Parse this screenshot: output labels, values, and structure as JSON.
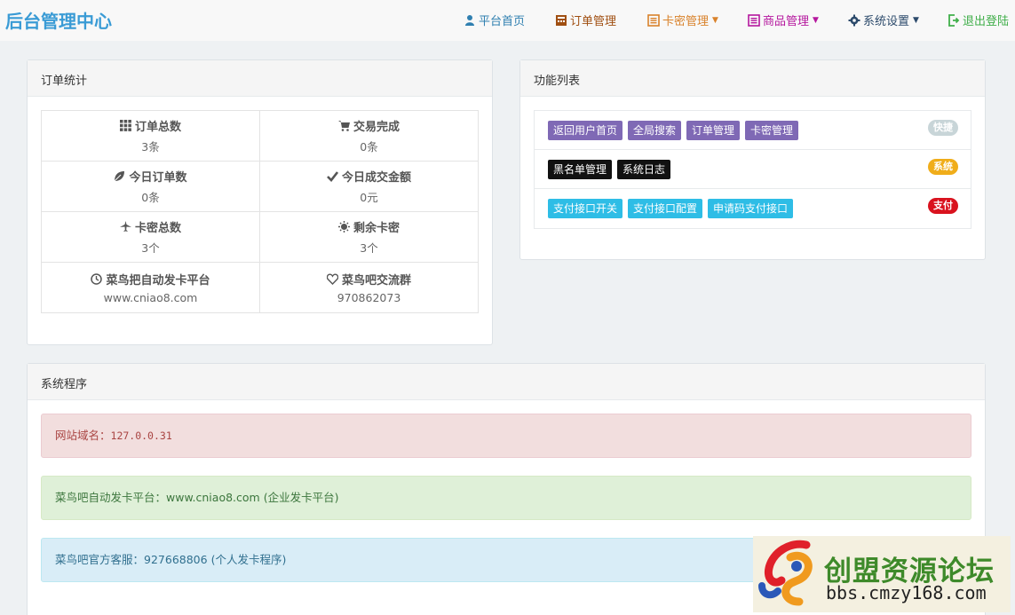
{
  "brand": "后台管理中心",
  "nav": [
    {
      "label": "平台首页",
      "color": "#2f7fb0",
      "icon": "user-icon",
      "dropdown": false
    },
    {
      "label": "订单管理",
      "color": "#a04f12",
      "icon": "calculator-icon",
      "dropdown": false
    },
    {
      "label": "卡密管理",
      "color": "#d9822b",
      "icon": "list-icon",
      "dropdown": true
    },
    {
      "label": "商品管理",
      "color": "#b5179e",
      "icon": "book-icon",
      "dropdown": true
    },
    {
      "label": "系统设置",
      "color": "#2c4a6b",
      "icon": "gear-icon",
      "dropdown": true
    },
    {
      "label": "退出登陆",
      "color": "#3fae49",
      "icon": "logout-icon",
      "dropdown": false
    }
  ],
  "order_stats": {
    "title": "订单统计",
    "cells": [
      {
        "label": "订单总数",
        "value": "3条",
        "icon": "grid-icon"
      },
      {
        "label": "交易完成",
        "value": "0条",
        "icon": "cart-icon"
      },
      {
        "label": "今日订单数",
        "value": "0条",
        "icon": "leaf-icon"
      },
      {
        "label": "今日成交金额",
        "value": "0元",
        "icon": "check-icon"
      },
      {
        "label": "卡密总数",
        "value": "3个",
        "icon": "plane-icon"
      },
      {
        "label": "剩余卡密",
        "value": "3个",
        "icon": "sun-icon"
      },
      {
        "label": "菜鸟把自动发卡平台",
        "value": "www.cniao8.com",
        "icon": "clock-icon"
      },
      {
        "label": "菜鸟吧交流群",
        "value": "970862073",
        "icon": "heart-icon"
      }
    ]
  },
  "func_list": {
    "title": "功能列表",
    "rows": [
      {
        "items": [
          "返回用户首页",
          "全局搜索",
          "订单管理",
          "卡密管理"
        ],
        "style": "purple",
        "badge": "快捷",
        "badge_color": "#c8d5d8"
      },
      {
        "items": [
          "黑名单管理",
          "系统日志"
        ],
        "style": "black",
        "badge": "系统",
        "badge_color": "#f0ad1a"
      },
      {
        "items": [
          "支付接口开关",
          "支付接口配置",
          "申请码支付接口"
        ],
        "style": "cyan",
        "badge": "支付",
        "badge_color": "#d9121e"
      }
    ]
  },
  "system": {
    "title": "系统程序",
    "domain_label": "网站域名：",
    "domain_value": "127.0.0.31",
    "platform_label": "菜鸟吧自动发卡平台：",
    "platform_url": "www.cniao8.com",
    "platform_note": "(企业发卡平台)",
    "service_label": "菜鸟吧官方客服：",
    "service_qq": "927668806",
    "service_note": "(个人发卡程序)"
  },
  "watermark": {
    "title": "创盟资源论坛",
    "url": "bbs.cmzy168.com"
  }
}
